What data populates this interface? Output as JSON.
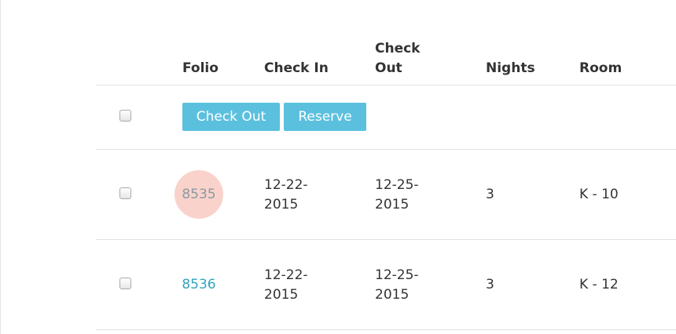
{
  "columns": {
    "folio": "Folio",
    "check_in": "Check In",
    "check_out_line1": "Check",
    "check_out_line2": "Out",
    "nights": "Nights",
    "room": "Room"
  },
  "actions": {
    "check_out_label": "Check Out",
    "reserve_label": "Reserve",
    "button_color": "#5bc0de"
  },
  "rows": [
    {
      "folio": "8535",
      "check_in_line1": "12-22-",
      "check_in_line2": "2015",
      "check_out_line1": "12-25-",
      "check_out_line2": "2015",
      "nights": "3",
      "room": "K - 10",
      "highlighted": true
    },
    {
      "folio": "8536",
      "check_in_line1": "12-22-",
      "check_in_line2": "2015",
      "check_out_line1": "12-25-",
      "check_out_line2": "2015",
      "nights": "3",
      "room": "K - 12",
      "highlighted": false
    }
  ],
  "colors": {
    "link": "#31a4c0",
    "highlight": "#f9d3cb"
  }
}
